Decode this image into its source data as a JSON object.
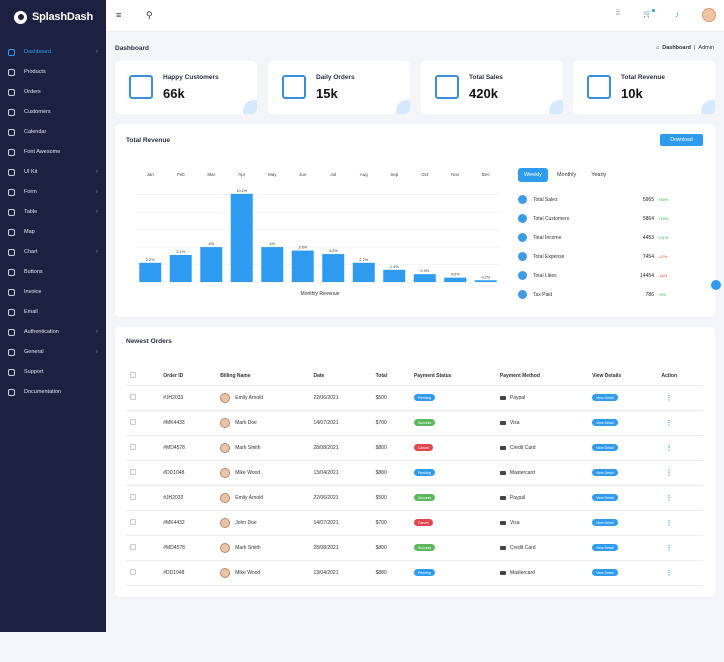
{
  "brand": {
    "name": "SplashDash"
  },
  "sidebar": {
    "items": [
      {
        "label": "Dashboard",
        "icon": "grid-icon",
        "active": true,
        "chevron": true
      },
      {
        "label": "Products",
        "icon": "box-icon"
      },
      {
        "label": "Orders",
        "icon": "truck-icon"
      },
      {
        "label": "Customers",
        "icon": "users-icon"
      },
      {
        "label": "Calendar",
        "icon": "calendar-icon"
      },
      {
        "label": "Font Awesome",
        "icon": "font-awesome-icon"
      },
      {
        "label": "UI Kit",
        "icon": "layers-icon",
        "chevron": true
      },
      {
        "label": "Form",
        "icon": "send-icon",
        "chevron": true
      },
      {
        "label": "Table",
        "icon": "table-icon",
        "chevron": true
      },
      {
        "label": "Map",
        "icon": "map-icon"
      },
      {
        "label": "Chart",
        "icon": "chart-icon",
        "chevron": true
      },
      {
        "label": "Buttons",
        "icon": "button-icon"
      },
      {
        "label": "Invoice",
        "icon": "invoice-icon"
      },
      {
        "label": "Email",
        "icon": "mail-icon"
      },
      {
        "label": "Authentication",
        "icon": "lock-icon",
        "chevron": true
      },
      {
        "label": "General",
        "icon": "stack-icon",
        "chevron": true
      },
      {
        "label": "Support",
        "icon": "support-icon"
      },
      {
        "label": "Documentation",
        "icon": "doc-icon"
      }
    ]
  },
  "topbar": {
    "menu_icon": "hamburger-icon",
    "search_icon": "search-icon",
    "glyphs": {
      "menu": "≡",
      "search": "⚲",
      "grid": "⁞⁞",
      "cart": "🛒",
      "bell": "♪"
    }
  },
  "page": {
    "title": "Dashboard",
    "breadcrumb_home": "Dashboard",
    "breadcrumb_sep": "|",
    "breadcrumb_current": "Admin",
    "home_glyph": "⌂"
  },
  "stats": [
    {
      "label": "Happy Customers",
      "value": "66k",
      "icon": "chart-bars-icon"
    },
    {
      "label": "Daily Orders",
      "value": "15k",
      "icon": "store-icon"
    },
    {
      "label": "Total Sales",
      "value": "420k",
      "icon": "register-icon"
    },
    {
      "label": "Total Revenue",
      "value": "10k",
      "icon": "money-icon"
    }
  ],
  "revenue": {
    "title": "Total Revenue",
    "download_label": "Download",
    "tabs": [
      "Weekly",
      "Monthly",
      "Yearly"
    ],
    "active_tab": 0,
    "metrics": [
      {
        "label": "Total Sales",
        "value": "5965",
        "change": "+15%",
        "up": true
      },
      {
        "label": "Total Customers",
        "value": "5864",
        "change": "+15%",
        "up": true
      },
      {
        "label": "Total Income",
        "value": "4453",
        "change": "+21%",
        "up": true
      },
      {
        "label": "Total Expense",
        "value": "7454",
        "change": "-12%",
        "up": false
      },
      {
        "label": "Total Likes",
        "value": "14454",
        "change": "-16%",
        "up": false
      },
      {
        "label": "Tax Paid",
        "value": "786",
        "change": "+5%",
        "up": true
      }
    ]
  },
  "chart_data": {
    "type": "bar",
    "categories": [
      "Jan",
      "Feb",
      "Mar",
      "Apr",
      "May",
      "Jun",
      "Jul",
      "Aug",
      "Sep",
      "Oct",
      "Nov",
      "Dec"
    ],
    "values": [
      2.2,
      3.1,
      4,
      10.1,
      4,
      3.6,
      3.2,
      2.2,
      1.4,
      0.9,
      0.5,
      0.2
    ],
    "data_labels": [
      "2.2%",
      "3.1%",
      "4%",
      "10.1%",
      "4%",
      "3.6%",
      "3.2%",
      "2.2%",
      "1.4%",
      "0.9%",
      "0.5%",
      "0.2%"
    ],
    "xlabel": "Monthly Revenue",
    "ylabel": "",
    "ylim": [
      0,
      11
    ],
    "grid": true,
    "bar_color": "#2f9bf0"
  },
  "orders": {
    "title": "Newest Orders",
    "columns": [
      "Order ID",
      "Billing Name",
      "Date",
      "Total",
      "Payment Status",
      "Payment Method",
      "View Details",
      "Action"
    ],
    "view_label": "View Detail",
    "action_glyph": "⋮",
    "rows": [
      {
        "id": "#JH2033",
        "name": "Emily Arnold",
        "date": "22/06/2021",
        "total": "$500",
        "status": "Pending",
        "status_color": "#2f9bf0",
        "method": "Paypal"
      },
      {
        "id": "#MK4433",
        "name": "Mark Doe",
        "date": "14/07/2021",
        "total": "$700",
        "status": "Success",
        "status_color": "#5cb85c",
        "method": "Visa"
      },
      {
        "id": "#MD4578",
        "name": "Mark Smith",
        "date": "28/08/2021",
        "total": "$800",
        "status": "Cancel",
        "status_color": "#e2464d",
        "method": "Credit Card"
      },
      {
        "id": "#DD1048",
        "name": "Mike Wood",
        "date": "13/04/2021",
        "total": "$880",
        "status": "Pending",
        "status_color": "#2f9bf0",
        "method": "Mastercard"
      },
      {
        "id": "#JH2033",
        "name": "Emily Arnold",
        "date": "22/06/2021",
        "total": "$500",
        "status": "Success",
        "status_color": "#5cb85c",
        "method": "Paypal"
      },
      {
        "id": "#MK4432",
        "name": "John Doe",
        "date": "14/07/2021",
        "total": "$700",
        "status": "Cancel",
        "status_color": "#e2464d",
        "method": "Visa"
      },
      {
        "id": "#MD4578",
        "name": "Mark Smith",
        "date": "28/08/2021",
        "total": "$800",
        "status": "Success",
        "status_color": "#5cb85c",
        "method": "Credit Card"
      },
      {
        "id": "#DD1048",
        "name": "Mike Wood",
        "date": "13/04/2021",
        "total": "$880",
        "status": "Pending",
        "status_color": "#2f9bf0",
        "method": "Mastercard"
      }
    ]
  }
}
